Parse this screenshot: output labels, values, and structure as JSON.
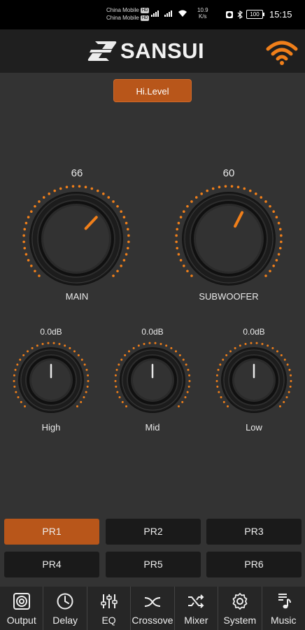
{
  "status_bar": {
    "carrier1": "China Mobile",
    "carrier1_tag": "HD",
    "carrier2": "China Mobile",
    "carrier2_tag": "HD",
    "network_speed_value": "10.9",
    "network_speed_unit": "K/s",
    "battery": "100",
    "time": "15:15"
  },
  "header": {
    "brand": "SANSUI",
    "accent_color": "#f07f1a"
  },
  "level_button": "Hi.Level",
  "main_knobs": [
    {
      "label": "MAIN",
      "value": "66",
      "level": 66
    },
    {
      "label": "SUBWOOFER",
      "value": "60",
      "level": 60
    }
  ],
  "eq_knobs": [
    {
      "label": "High",
      "value": "0.0dB",
      "level": 0
    },
    {
      "label": "Mid",
      "value": "0.0dB",
      "level": 0
    },
    {
      "label": "Low",
      "value": "0.0dB",
      "level": 0
    }
  ],
  "presets": [
    {
      "label": "PR1",
      "active": true
    },
    {
      "label": "PR2",
      "active": false
    },
    {
      "label": "PR3",
      "active": false
    },
    {
      "label": "PR4",
      "active": false
    },
    {
      "label": "PR5",
      "active": false
    },
    {
      "label": "PR6",
      "active": false
    }
  ],
  "nav": [
    {
      "label": "Output",
      "icon": "speaker-icon"
    },
    {
      "label": "Delay",
      "icon": "clock-icon"
    },
    {
      "label": "EQ",
      "icon": "equalizer-icon"
    },
    {
      "label": "Crossove",
      "icon": "crossover-icon"
    },
    {
      "label": "Mixer",
      "icon": "shuffle-icon"
    },
    {
      "label": "System",
      "icon": "gear-icon"
    },
    {
      "label": "Music",
      "icon": "music-note-icon"
    }
  ]
}
